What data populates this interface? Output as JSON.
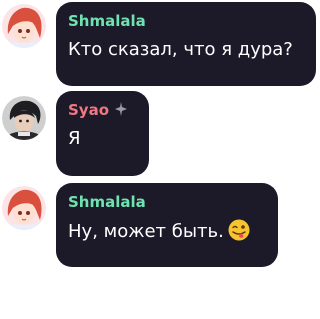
{
  "messages": [
    {
      "sender": "Shmalala",
      "sender_color": "#6ee3b0",
      "avatar": "anime-girl-red-hair-avatar",
      "text": "Кто сказал, что я дура?"
    },
    {
      "sender": "Syao",
      "sender_color": "#f07883",
      "avatar": "dark-haired-boy-avatar",
      "sender_icon": "sparkle-icon",
      "text": "Я"
    },
    {
      "sender": "Shmalala",
      "sender_color": "#6ee3b0",
      "avatar": "anime-girl-red-hair-avatar",
      "text": "Ну, может быть.",
      "trailing_emoji": "winking-tongue-emoji"
    }
  ],
  "colors": {
    "bubble_bg": "#1c1929",
    "message_text": "#ffffff",
    "page_bg": "#ffffff"
  }
}
